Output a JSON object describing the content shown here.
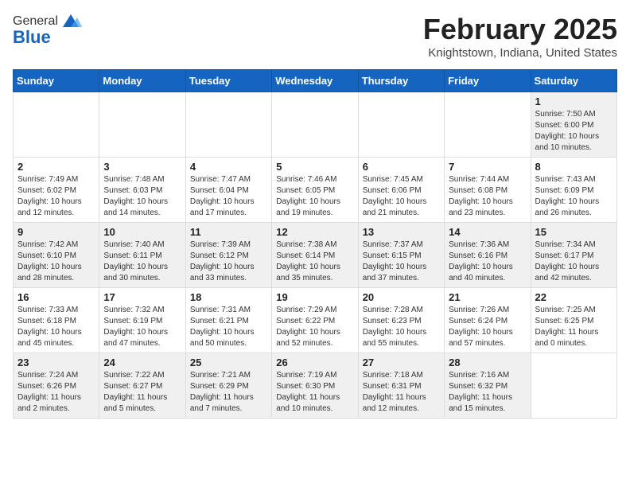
{
  "header": {
    "logo_general": "General",
    "logo_blue": "Blue",
    "month_title": "February 2025",
    "location": "Knightstown, Indiana, United States"
  },
  "weekdays": [
    "Sunday",
    "Monday",
    "Tuesday",
    "Wednesday",
    "Thursday",
    "Friday",
    "Saturday"
  ],
  "weeks": [
    [
      {
        "day": "",
        "info": ""
      },
      {
        "day": "",
        "info": ""
      },
      {
        "day": "",
        "info": ""
      },
      {
        "day": "",
        "info": ""
      },
      {
        "day": "",
        "info": ""
      },
      {
        "day": "",
        "info": ""
      },
      {
        "day": "1",
        "info": "Sunrise: 7:50 AM\nSunset: 6:00 PM\nDaylight: 10 hours\nand 10 minutes."
      }
    ],
    [
      {
        "day": "2",
        "info": "Sunrise: 7:49 AM\nSunset: 6:02 PM\nDaylight: 10 hours\nand 12 minutes."
      },
      {
        "day": "3",
        "info": "Sunrise: 7:48 AM\nSunset: 6:03 PM\nDaylight: 10 hours\nand 14 minutes."
      },
      {
        "day": "4",
        "info": "Sunrise: 7:47 AM\nSunset: 6:04 PM\nDaylight: 10 hours\nand 17 minutes."
      },
      {
        "day": "5",
        "info": "Sunrise: 7:46 AM\nSunset: 6:05 PM\nDaylight: 10 hours\nand 19 minutes."
      },
      {
        "day": "6",
        "info": "Sunrise: 7:45 AM\nSunset: 6:06 PM\nDaylight: 10 hours\nand 21 minutes."
      },
      {
        "day": "7",
        "info": "Sunrise: 7:44 AM\nSunset: 6:08 PM\nDaylight: 10 hours\nand 23 minutes."
      },
      {
        "day": "8",
        "info": "Sunrise: 7:43 AM\nSunset: 6:09 PM\nDaylight: 10 hours\nand 26 minutes."
      }
    ],
    [
      {
        "day": "9",
        "info": "Sunrise: 7:42 AM\nSunset: 6:10 PM\nDaylight: 10 hours\nand 28 minutes."
      },
      {
        "day": "10",
        "info": "Sunrise: 7:40 AM\nSunset: 6:11 PM\nDaylight: 10 hours\nand 30 minutes."
      },
      {
        "day": "11",
        "info": "Sunrise: 7:39 AM\nSunset: 6:12 PM\nDaylight: 10 hours\nand 33 minutes."
      },
      {
        "day": "12",
        "info": "Sunrise: 7:38 AM\nSunset: 6:14 PM\nDaylight: 10 hours\nand 35 minutes."
      },
      {
        "day": "13",
        "info": "Sunrise: 7:37 AM\nSunset: 6:15 PM\nDaylight: 10 hours\nand 37 minutes."
      },
      {
        "day": "14",
        "info": "Sunrise: 7:36 AM\nSunset: 6:16 PM\nDaylight: 10 hours\nand 40 minutes."
      },
      {
        "day": "15",
        "info": "Sunrise: 7:34 AM\nSunset: 6:17 PM\nDaylight: 10 hours\nand 42 minutes."
      }
    ],
    [
      {
        "day": "16",
        "info": "Sunrise: 7:33 AM\nSunset: 6:18 PM\nDaylight: 10 hours\nand 45 minutes."
      },
      {
        "day": "17",
        "info": "Sunrise: 7:32 AM\nSunset: 6:19 PM\nDaylight: 10 hours\nand 47 minutes."
      },
      {
        "day": "18",
        "info": "Sunrise: 7:31 AM\nSunset: 6:21 PM\nDaylight: 10 hours\nand 50 minutes."
      },
      {
        "day": "19",
        "info": "Sunrise: 7:29 AM\nSunset: 6:22 PM\nDaylight: 10 hours\nand 52 minutes."
      },
      {
        "day": "20",
        "info": "Sunrise: 7:28 AM\nSunset: 6:23 PM\nDaylight: 10 hours\nand 55 minutes."
      },
      {
        "day": "21",
        "info": "Sunrise: 7:26 AM\nSunset: 6:24 PM\nDaylight: 10 hours\nand 57 minutes."
      },
      {
        "day": "22",
        "info": "Sunrise: 7:25 AM\nSunset: 6:25 PM\nDaylight: 11 hours\nand 0 minutes."
      }
    ],
    [
      {
        "day": "23",
        "info": "Sunrise: 7:24 AM\nSunset: 6:26 PM\nDaylight: 11 hours\nand 2 minutes."
      },
      {
        "day": "24",
        "info": "Sunrise: 7:22 AM\nSunset: 6:27 PM\nDaylight: 11 hours\nand 5 minutes."
      },
      {
        "day": "25",
        "info": "Sunrise: 7:21 AM\nSunset: 6:29 PM\nDaylight: 11 hours\nand 7 minutes."
      },
      {
        "day": "26",
        "info": "Sunrise: 7:19 AM\nSunset: 6:30 PM\nDaylight: 11 hours\nand 10 minutes."
      },
      {
        "day": "27",
        "info": "Sunrise: 7:18 AM\nSunset: 6:31 PM\nDaylight: 11 hours\nand 12 minutes."
      },
      {
        "day": "28",
        "info": "Sunrise: 7:16 AM\nSunset: 6:32 PM\nDaylight: 11 hours\nand 15 minutes."
      },
      {
        "day": "",
        "info": ""
      }
    ]
  ]
}
